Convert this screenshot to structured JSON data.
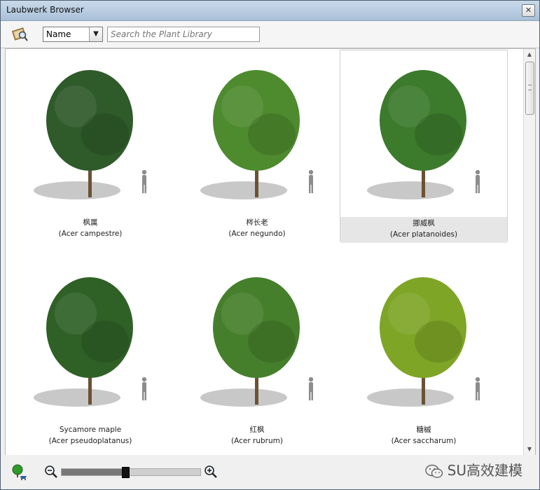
{
  "window": {
    "title": "Laubwerk Browser",
    "close_glyph": "✕"
  },
  "toolbar": {
    "sort_select": {
      "value": "Name",
      "arrow_glyph": "▼"
    },
    "search": {
      "placeholder": "Search the Plant Library",
      "value": ""
    }
  },
  "plants": [
    {
      "name": "枫属",
      "latin": "(Acer campestre)",
      "selected": false,
      "color": "#2f5a2a"
    },
    {
      "name": "梣长老",
      "latin": "(Acer negundo)",
      "selected": false,
      "color": "#4e8a2e"
    },
    {
      "name": "挪威枫",
      "latin": "(Acer platanoides)",
      "selected": true,
      "color": "#3c7a2c"
    },
    {
      "name": "Sycamore maple",
      "latin": "(Acer pseudoplatanus)",
      "selected": false,
      "color": "#2f6127"
    },
    {
      "name": "红枫",
      "latin": "(Acer rubrum)",
      "selected": false,
      "color": "#467f2b"
    },
    {
      "name": "糖槭",
      "latin": "(Acer saccharum)",
      "selected": false,
      "color": "#7ea526"
    }
  ],
  "scrollbar": {
    "up_glyph": "▲",
    "down_glyph": "▼",
    "position": 0
  },
  "zoom": {
    "level": 0.46
  },
  "watermark": {
    "text": "SU高效建模"
  }
}
